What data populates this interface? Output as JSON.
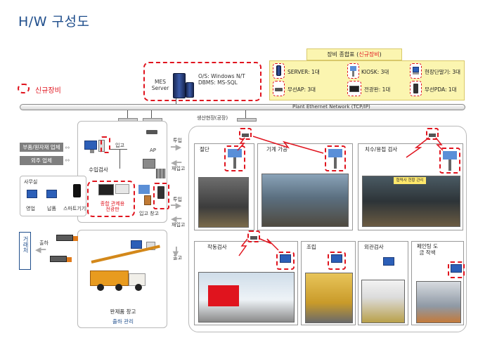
{
  "title": "H/W 구성도",
  "legend": {
    "label": "신규장비"
  },
  "mes": {
    "server_label": "MES Server",
    "os": "O/S: Windows N/T",
    "dbms": "DBMS:  MS-SQL"
  },
  "summary": {
    "title_prefix": "장비 종합표 (",
    "title_highlight": "신규장비",
    "title_suffix": ")",
    "items": [
      "SERVER: 1대",
      "KIOSK: 3대",
      "현장단말기: 3대",
      "무선AP: 3대",
      "전광판: 1대",
      "무선PDA: 1대"
    ]
  },
  "network": {
    "label": "Plant Ethernet Network (TCP/IP)"
  },
  "factory": {
    "label": "생산현장(공장)"
  },
  "left": {
    "partners": [
      "부품/원자재 업체",
      "외주 업체"
    ],
    "receiving": "수입검사",
    "office": {
      "label": "사무실",
      "terminals": [
        "영업",
        "납품",
        "스마트기기"
      ]
    },
    "board": "종합 관제용\n전광판",
    "ap": "AP",
    "in_flow": "입고",
    "warehouse": "입고 창고",
    "finished": "완제품 창고",
    "shipping": "출하 관리",
    "customer": "거래처",
    "ship": "출하",
    "out": "출고"
  },
  "flow": {
    "in": "투입",
    "re_in": "재입고"
  },
  "stations": [
    "절단",
    "기계 가공",
    "치수/용접 검사",
    "작동검사",
    "조립",
    "외관검사",
    "페인팅 도금 작색"
  ],
  "misc": {
    "sign_text": "협력사 현황 관리"
  }
}
